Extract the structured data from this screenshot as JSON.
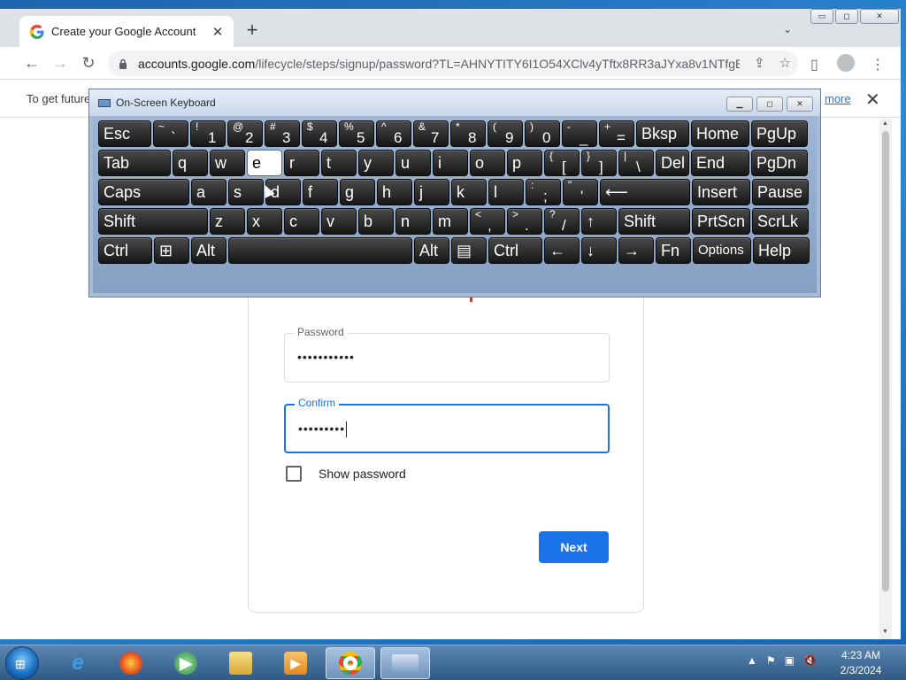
{
  "browser": {
    "tab_title": "Create your Google Account",
    "tab_close": "✕",
    "new_tab": "+",
    "url_host": "accounts.google.com",
    "url_path": "/lifecycle/steps/signup/password?TL=AHNYTITY6I1O54XClv4yTftx8RR3aJYxa8v1NTfgB...",
    "window_buttons": [
      "▭",
      "◻",
      "✕"
    ]
  },
  "infobar": {
    "message": "To get future",
    "link": "more",
    "close": "✕"
  },
  "form": {
    "password_label": "Password",
    "password_value": "•••••••••••",
    "confirm_label": "Confirm",
    "confirm_value": "•••••••••",
    "show_password_label": "Show password",
    "next_button": "Next"
  },
  "osk": {
    "title": "On-Screen Keyboard",
    "rows": [
      [
        {
          "label": "Esc",
          "w": 60
        },
        {
          "sh": "~",
          "mn": "`",
          "w": 40
        },
        {
          "sh": "!",
          "mn": "1",
          "w": 40
        },
        {
          "sh": "@",
          "mn": "2",
          "w": 40
        },
        {
          "sh": "#",
          "mn": "3",
          "w": 40
        },
        {
          "sh": "$",
          "mn": "4",
          "w": 40
        },
        {
          "sh": "%",
          "mn": "5",
          "w": 40
        },
        {
          "sh": "^",
          "mn": "6",
          "w": 40
        },
        {
          "sh": "&",
          "mn": "7",
          "w": 40
        },
        {
          "sh": "*",
          "mn": "8",
          "w": 40
        },
        {
          "sh": "(",
          "mn": "9",
          "w": 40
        },
        {
          "sh": ")",
          "mn": "0",
          "w": 40
        },
        {
          "sh": "-",
          "mn": "_",
          "w": 40
        },
        {
          "sh": "+",
          "mn": "=",
          "w": 40
        },
        {
          "label": "Bksp",
          "w": 60
        },
        {
          "label": "Home",
          "w": 66
        },
        {
          "label": "PgUp",
          "w": 64
        }
      ],
      [
        {
          "label": "Tab",
          "w": 82
        },
        {
          "label": "q",
          "w": 40
        },
        {
          "label": "w",
          "w": 40
        },
        {
          "label": "e",
          "w": 40,
          "hl": true
        },
        {
          "label": "r",
          "w": 40
        },
        {
          "label": "t",
          "w": 40
        },
        {
          "label": "y",
          "w": 40
        },
        {
          "label": "u",
          "w": 40
        },
        {
          "label": "i",
          "w": 40
        },
        {
          "label": "o",
          "w": 40
        },
        {
          "label": "p",
          "w": 40
        },
        {
          "sh": "{",
          "mn": "[",
          "w": 40
        },
        {
          "sh": "}",
          "mn": "]",
          "w": 40
        },
        {
          "sh": "|",
          "mn": "\\",
          "w": 40
        },
        {
          "label": "Del",
          "w": 38
        },
        {
          "label": "End",
          "w": 66
        },
        {
          "label": "PgDn",
          "w": 64
        }
      ],
      [
        {
          "label": "Caps",
          "w": 103
        },
        {
          "label": "a",
          "w": 40
        },
        {
          "label": "s",
          "w": 40
        },
        {
          "label": "d",
          "w": 40
        },
        {
          "label": "f",
          "w": 40
        },
        {
          "label": "g",
          "w": 40
        },
        {
          "label": "h",
          "w": 40
        },
        {
          "label": "j",
          "w": 40
        },
        {
          "label": "k",
          "w": 40
        },
        {
          "label": "l",
          "w": 40
        },
        {
          "sh": ":",
          "mn": ";",
          "w": 40
        },
        {
          "sh": "\"",
          "mn": "'",
          "w": 40
        },
        {
          "label": "⟵",
          "w": 102
        },
        {
          "label": "Insert",
          "w": 66
        },
        {
          "label": "Pause",
          "w": 64
        }
      ],
      [
        {
          "label": "Shift",
          "w": 124
        },
        {
          "label": "z",
          "w": 40
        },
        {
          "label": "x",
          "w": 40
        },
        {
          "label": "c",
          "w": 40
        },
        {
          "label": "v",
          "w": 40
        },
        {
          "label": "b",
          "w": 40
        },
        {
          "label": "n",
          "w": 40
        },
        {
          "label": "m",
          "w": 40
        },
        {
          "sh": "<",
          "mn": ",",
          "w": 40
        },
        {
          "sh": ">",
          "mn": ".",
          "w": 40
        },
        {
          "sh": "?",
          "mn": "/",
          "w": 40
        },
        {
          "label": "↑",
          "w": 40
        },
        {
          "label": "Shift",
          "w": 81
        },
        {
          "label": "PrtScn",
          "w": 66
        },
        {
          "label": "ScrLk",
          "w": 64
        }
      ],
      [
        {
          "label": "Ctrl",
          "w": 61
        },
        {
          "label": "⊞",
          "w": 40
        },
        {
          "label": "Alt",
          "w": 40
        },
        {
          "label": "",
          "w": 208
        },
        {
          "label": "Alt",
          "w": 40
        },
        {
          "label": "▤",
          "w": 40
        },
        {
          "label": "Ctrl",
          "w": 61
        },
        {
          "label": "←",
          "w": 40
        },
        {
          "label": "↓",
          "w": 40
        },
        {
          "label": "→",
          "w": 40
        },
        {
          "label": "Fn",
          "w": 40
        },
        {
          "label": "Options",
          "w": 66,
          "small": true
        },
        {
          "label": "Help",
          "w": 64
        }
      ]
    ]
  },
  "taskbar": {
    "clock_time": "4:23 AM",
    "clock_date": "2/3/2024"
  },
  "colors": {
    "accent": "#1a73e8",
    "osk_key": "#1e1e1e",
    "osk_bg": "#9fb7d6"
  }
}
